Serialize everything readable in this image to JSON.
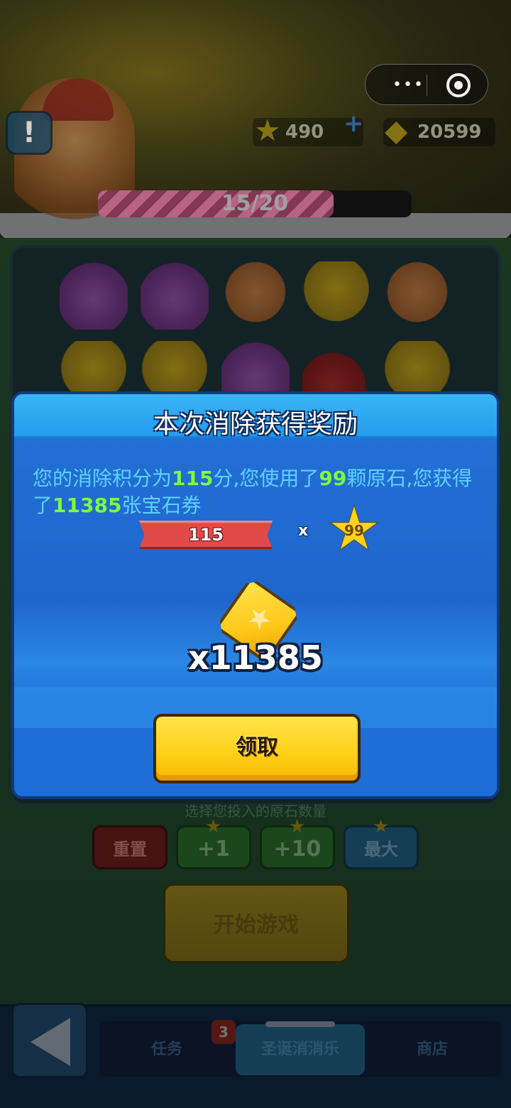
{
  "header": {
    "stars": "490",
    "gems": "20599",
    "progress_text": "15/20",
    "progress_fraction": 0.75
  },
  "board": {
    "row1": [
      "gift",
      "gift",
      "gingerbread",
      "bell",
      "gingerbread"
    ],
    "row2": [
      "bell",
      "bell",
      "gift",
      "santa-hat",
      "bell"
    ]
  },
  "controls": {
    "hint": "选择您投入的原石数量",
    "reset": "重置",
    "plus1": "+1",
    "plus10": "+10",
    "max": "最大",
    "start": "开始游戏"
  },
  "nav": {
    "tasks": "任务",
    "christmas": "圣诞消消乐",
    "shop": "商店",
    "badge": "3"
  },
  "modal": {
    "title": "本次消除获得奖励",
    "desc_1": "您的消除积分为",
    "score": "115",
    "desc_2": "分,您使用了",
    "stones": "99",
    "desc_3": "颗原石,您获得了",
    "tickets": "11385",
    "desc_4": "张宝石券",
    "score_flag": "115",
    "multiply": "x",
    "star_value": "99",
    "reward": "x11385",
    "claim": "领取"
  },
  "icons": {
    "info": "exclamation-icon",
    "star": "star-icon",
    "gem": "gem-ticket-icon",
    "back": "back-arrow-icon"
  }
}
